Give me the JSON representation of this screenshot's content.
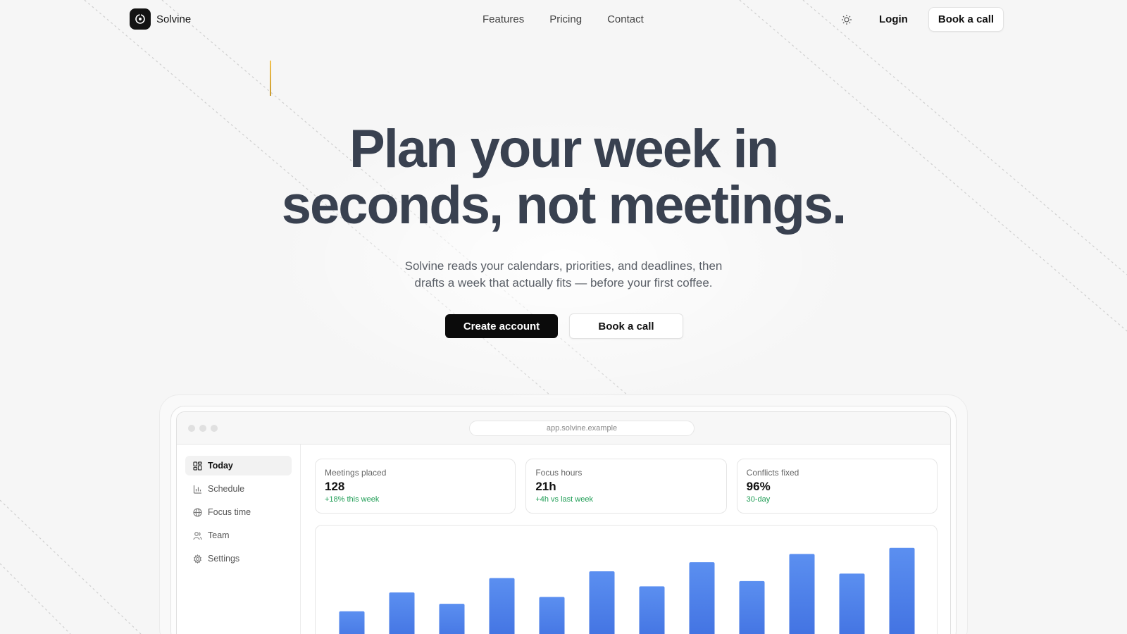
{
  "brand": {
    "name": "Solvine"
  },
  "nav": {
    "links": [
      "Features",
      "Pricing",
      "Contact"
    ],
    "login": "Login",
    "cta": "Book a call"
  },
  "hero": {
    "title_line1": "Plan your week in",
    "title_line2": "seconds, not meetings.",
    "subtitle_line1": "Solvine reads your calendars, priorities, and deadlines, then",
    "subtitle_line2": "drafts a week that actually fits — before your first coffee.",
    "primary_cta": "Create account",
    "secondary_cta": "Book a call"
  },
  "app": {
    "url": "app.solvine.example",
    "sidebar": [
      {
        "label": "Today",
        "icon": "dashboard-icon",
        "active": true
      },
      {
        "label": "Schedule",
        "icon": "bar-chart-icon",
        "active": false
      },
      {
        "label": "Focus time",
        "icon": "globe-icon",
        "active": false
      },
      {
        "label": "Team",
        "icon": "users-icon",
        "active": false
      },
      {
        "label": "Settings",
        "icon": "gear-icon",
        "active": false
      }
    ],
    "stats": [
      {
        "label": "Meetings placed",
        "value": "128",
        "delta": "+18% this week"
      },
      {
        "label": "Focus hours",
        "value": "21h",
        "delta": "+4h vs last week"
      },
      {
        "label": "Conflicts fixed",
        "value": "96%",
        "delta": "30-day"
      }
    ]
  },
  "colors": {
    "accent_green": "#1f9d55",
    "bar_top": "#5b8ff0",
    "bar_bottom": "#3f6fe0",
    "headline": "#394150"
  },
  "chart_data": {
    "type": "bar",
    "values": [
      45,
      70,
      55,
      89,
      64,
      98,
      78,
      110,
      85,
      121,
      95,
      129
    ],
    "ylim": [
      0,
      140
    ],
    "grid": false,
    "title": "",
    "xlabel": "",
    "ylabel": ""
  }
}
